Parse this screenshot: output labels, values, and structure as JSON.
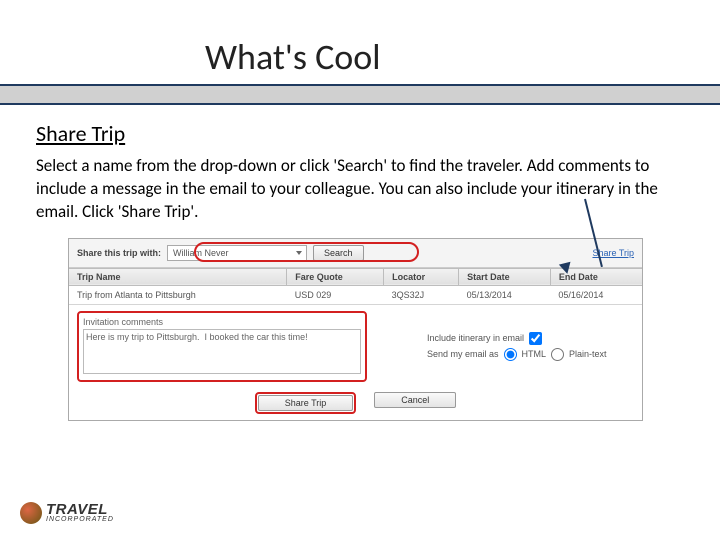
{
  "title": "What's Cool",
  "subtitle": "Share Trip",
  "body": "Select a name from the drop-down or click 'Search' to find the traveler. Add comments to include a message in the email to your colleague. You can also include your itinerary in the email.  Click 'Share Trip'.",
  "ui": {
    "share_label": "Share this trip with:",
    "selected_traveler": "William Never",
    "search_btn": "Search",
    "share_link": "Share Trip",
    "table": {
      "headers": [
        "Trip Name",
        "Fare Quote",
        "Locator",
        "Start Date",
        "End Date"
      ],
      "row": [
        "Trip from Atlanta to Pittsburgh",
        "USD 029",
        "3QS32J",
        "05/13/2014",
        "05/16/2014"
      ]
    },
    "comment_label": "Invitation comments",
    "comment_text": "Here is my trip to Pittsburgh.  I booked the car this time!",
    "include_label": "Include itinerary in email",
    "send_as_label": "Send my email as",
    "html": "HTML",
    "plain": "Plain-text",
    "share_btn": "Share Trip",
    "cancel_btn": "Cancel"
  },
  "logo": {
    "brand": "TRAVEL",
    "sub": "INCORPORATED"
  }
}
